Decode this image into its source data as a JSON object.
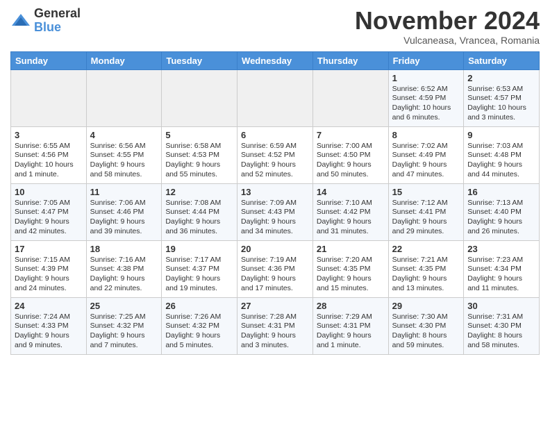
{
  "logo": {
    "general": "General",
    "blue": "Blue"
  },
  "title": "November 2024",
  "subtitle": "Vulcaneasa, Vrancea, Romania",
  "headers": [
    "Sunday",
    "Monday",
    "Tuesday",
    "Wednesday",
    "Thursday",
    "Friday",
    "Saturday"
  ],
  "weeks": [
    [
      {
        "day": "",
        "info": ""
      },
      {
        "day": "",
        "info": ""
      },
      {
        "day": "",
        "info": ""
      },
      {
        "day": "",
        "info": ""
      },
      {
        "day": "",
        "info": ""
      },
      {
        "day": "1",
        "info": "Sunrise: 6:52 AM\nSunset: 4:59 PM\nDaylight: 10 hours and 6 minutes."
      },
      {
        "day": "2",
        "info": "Sunrise: 6:53 AM\nSunset: 4:57 PM\nDaylight: 10 hours and 3 minutes."
      }
    ],
    [
      {
        "day": "3",
        "info": "Sunrise: 6:55 AM\nSunset: 4:56 PM\nDaylight: 10 hours and 1 minute."
      },
      {
        "day": "4",
        "info": "Sunrise: 6:56 AM\nSunset: 4:55 PM\nDaylight: 9 hours and 58 minutes."
      },
      {
        "day": "5",
        "info": "Sunrise: 6:58 AM\nSunset: 4:53 PM\nDaylight: 9 hours and 55 minutes."
      },
      {
        "day": "6",
        "info": "Sunrise: 6:59 AM\nSunset: 4:52 PM\nDaylight: 9 hours and 52 minutes."
      },
      {
        "day": "7",
        "info": "Sunrise: 7:00 AM\nSunset: 4:50 PM\nDaylight: 9 hours and 50 minutes."
      },
      {
        "day": "8",
        "info": "Sunrise: 7:02 AM\nSunset: 4:49 PM\nDaylight: 9 hours and 47 minutes."
      },
      {
        "day": "9",
        "info": "Sunrise: 7:03 AM\nSunset: 4:48 PM\nDaylight: 9 hours and 44 minutes."
      }
    ],
    [
      {
        "day": "10",
        "info": "Sunrise: 7:05 AM\nSunset: 4:47 PM\nDaylight: 9 hours and 42 minutes."
      },
      {
        "day": "11",
        "info": "Sunrise: 7:06 AM\nSunset: 4:46 PM\nDaylight: 9 hours and 39 minutes."
      },
      {
        "day": "12",
        "info": "Sunrise: 7:08 AM\nSunset: 4:44 PM\nDaylight: 9 hours and 36 minutes."
      },
      {
        "day": "13",
        "info": "Sunrise: 7:09 AM\nSunset: 4:43 PM\nDaylight: 9 hours and 34 minutes."
      },
      {
        "day": "14",
        "info": "Sunrise: 7:10 AM\nSunset: 4:42 PM\nDaylight: 9 hours and 31 minutes."
      },
      {
        "day": "15",
        "info": "Sunrise: 7:12 AM\nSunset: 4:41 PM\nDaylight: 9 hours and 29 minutes."
      },
      {
        "day": "16",
        "info": "Sunrise: 7:13 AM\nSunset: 4:40 PM\nDaylight: 9 hours and 26 minutes."
      }
    ],
    [
      {
        "day": "17",
        "info": "Sunrise: 7:15 AM\nSunset: 4:39 PM\nDaylight: 9 hours and 24 minutes."
      },
      {
        "day": "18",
        "info": "Sunrise: 7:16 AM\nSunset: 4:38 PM\nDaylight: 9 hours and 22 minutes."
      },
      {
        "day": "19",
        "info": "Sunrise: 7:17 AM\nSunset: 4:37 PM\nDaylight: 9 hours and 19 minutes."
      },
      {
        "day": "20",
        "info": "Sunrise: 7:19 AM\nSunset: 4:36 PM\nDaylight: 9 hours and 17 minutes."
      },
      {
        "day": "21",
        "info": "Sunrise: 7:20 AM\nSunset: 4:35 PM\nDaylight: 9 hours and 15 minutes."
      },
      {
        "day": "22",
        "info": "Sunrise: 7:21 AM\nSunset: 4:35 PM\nDaylight: 9 hours and 13 minutes."
      },
      {
        "day": "23",
        "info": "Sunrise: 7:23 AM\nSunset: 4:34 PM\nDaylight: 9 hours and 11 minutes."
      }
    ],
    [
      {
        "day": "24",
        "info": "Sunrise: 7:24 AM\nSunset: 4:33 PM\nDaylight: 9 hours and 9 minutes."
      },
      {
        "day": "25",
        "info": "Sunrise: 7:25 AM\nSunset: 4:32 PM\nDaylight: 9 hours and 7 minutes."
      },
      {
        "day": "26",
        "info": "Sunrise: 7:26 AM\nSunset: 4:32 PM\nDaylight: 9 hours and 5 minutes."
      },
      {
        "day": "27",
        "info": "Sunrise: 7:28 AM\nSunset: 4:31 PM\nDaylight: 9 hours and 3 minutes."
      },
      {
        "day": "28",
        "info": "Sunrise: 7:29 AM\nSunset: 4:31 PM\nDaylight: 9 hours and 1 minute."
      },
      {
        "day": "29",
        "info": "Sunrise: 7:30 AM\nSunset: 4:30 PM\nDaylight: 8 hours and 59 minutes."
      },
      {
        "day": "30",
        "info": "Sunrise: 7:31 AM\nSunset: 4:30 PM\nDaylight: 8 hours and 58 minutes."
      }
    ]
  ]
}
